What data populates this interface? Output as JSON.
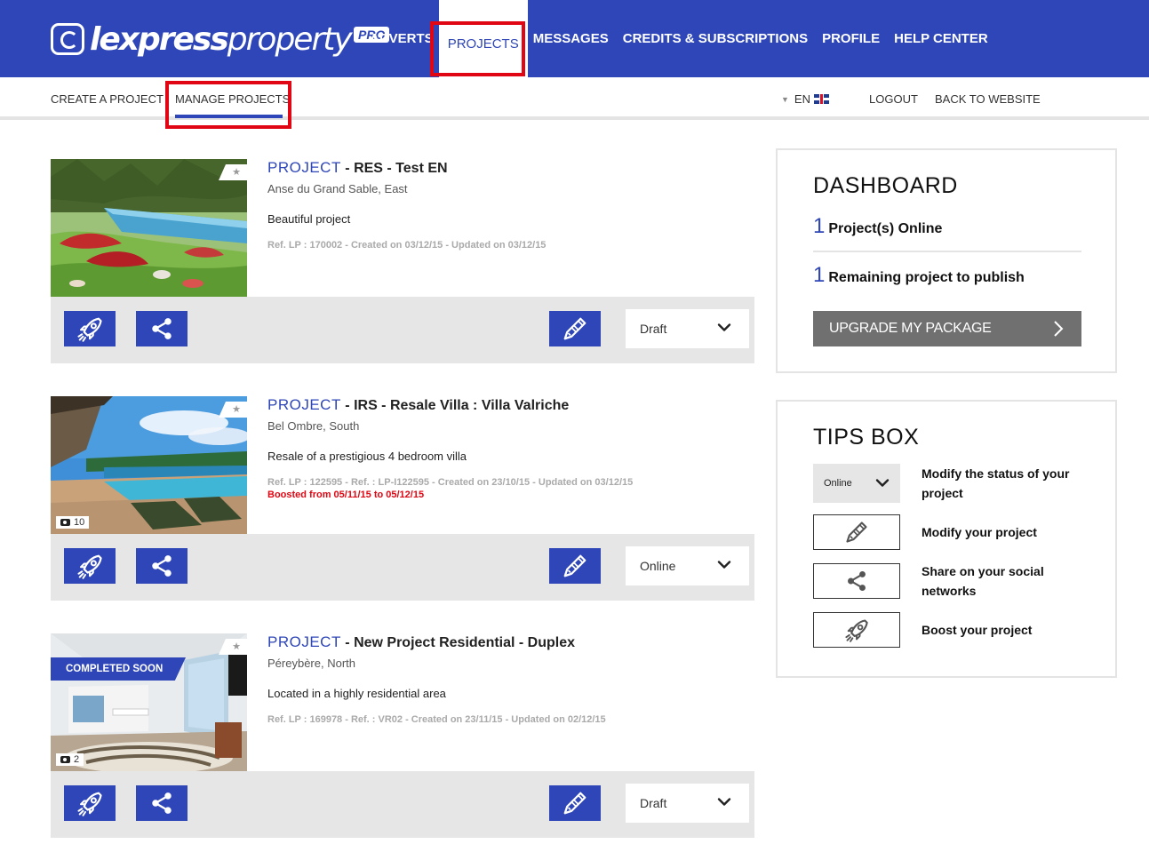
{
  "brand": {
    "name_bold": "lexpress",
    "name_light": "property",
    "badge": "PRO"
  },
  "main_nav": [
    {
      "label": "ADVERTS",
      "active": false
    },
    {
      "label": "PROJECTS",
      "active": true
    },
    {
      "label": "MESSAGES",
      "active": false
    },
    {
      "label": "CREDITS & SUBSCRIPTIONS",
      "active": false
    },
    {
      "label": "PROFILE",
      "active": false
    },
    {
      "label": "HELP CENTER",
      "active": false
    }
  ],
  "sub_nav": {
    "create": "CREATE A PROJECT",
    "manage": "MANAGE PROJECTS",
    "language": "EN",
    "logout": "LOGOUT",
    "back": "BACK TO WEBSITE"
  },
  "projects": [
    {
      "keyword": "PROJECT",
      "name": " - RES - Test EN",
      "location": "Anse du Grand Sable, East",
      "description": "Beautiful project",
      "ref": "Ref. LP : 170002 - Created on 03/12/15 - Updated on 03/12/15",
      "boost": "",
      "photos": "",
      "ribbon": "",
      "status": "Draft"
    },
    {
      "keyword": "PROJECT",
      "name": " - IRS - Resale Villa : Villa Valriche",
      "location": "Bel Ombre, South",
      "description": "Resale of a prestigious 4 bedroom villa",
      "ref": "Ref. LP : 122595 - Ref. : LP-I122595 - Created on 23/10/15 - Updated on 03/12/15",
      "boost": "Boosted from 05/11/15 to 05/12/15",
      "photos": "10",
      "ribbon": "",
      "status": "Online"
    },
    {
      "keyword": "PROJECT",
      "name": " - New Project Residential - Duplex",
      "location": "Péreybère, North",
      "description": "Located in a highly residential area",
      "ref": "Ref. LP : 169978 - Ref. : VR02 - Created on 23/11/15 - Updated on 02/12/15",
      "boost": "",
      "photos": "2",
      "ribbon": "COMPLETED SOON",
      "status": "Draft"
    }
  ],
  "dashboard": {
    "title": "DASHBOARD",
    "online_count": "1",
    "online_label": "Project(s) Online",
    "remaining_count": "1",
    "remaining_label": "Remaining project to publish",
    "upgrade_label": "UPGRADE MY PACKAGE"
  },
  "tips": {
    "title": "TIPS BOX",
    "status_sample": "Online",
    "items": [
      "Modify the status of your project",
      "Modify your project",
      "Share on your social networks",
      "Boost your project"
    ]
  },
  "colors": {
    "primary": "#2e46b7",
    "highlight": "#e10613",
    "boost": "#e10613",
    "button_grey": "#707070"
  },
  "icons": [
    "rocket-icon",
    "share-icon",
    "pencil-icon",
    "chevron-down-icon",
    "chevron-right-icon",
    "camera-icon",
    "star-icon",
    "uk-flag-icon"
  ]
}
